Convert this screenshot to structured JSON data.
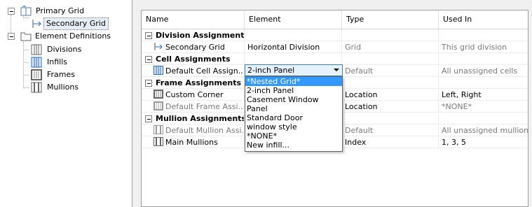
{
  "tree": {
    "nodes": [
      {
        "label": "Primary Grid",
        "icon": "grid-icon"
      },
      {
        "label": "Secondary Grid",
        "icon": "subgrid-icon"
      },
      {
        "label": "Element Definitions",
        "icon": "folder-icon"
      },
      {
        "label": "Divisions",
        "icon": "divisions-icon"
      },
      {
        "label": "Infills",
        "icon": "infills-icon"
      },
      {
        "label": "Frames",
        "icon": "frames-icon"
      },
      {
        "label": "Mullions",
        "icon": "mullions-icon"
      }
    ],
    "selected": "Secondary Grid"
  },
  "grid": {
    "columns": [
      "Name",
      "Element",
      "Type",
      "Used In"
    ],
    "rows": [
      {
        "kind": "group",
        "name": "Division Assignment"
      },
      {
        "kind": "item",
        "name": "Secondary Grid",
        "element": "Horizontal Division",
        "type": "Grid",
        "used_in": "This grid division"
      },
      {
        "kind": "group",
        "name": "Cell Assignments"
      },
      {
        "kind": "item",
        "name": "Default Cell Assign...",
        "element": "2-inch Panel",
        "type": "Default",
        "used_in": "All unassigned cells"
      },
      {
        "kind": "group",
        "name": "Frame Assignments"
      },
      {
        "kind": "item",
        "name": "Custom Corner",
        "element": "",
        "type": "Location",
        "used_in": "Left, Right"
      },
      {
        "kind": "item",
        "name": "Default Frame Assi...",
        "element": "",
        "type": "Location",
        "used_in": "*NONE*"
      },
      {
        "kind": "group",
        "name": "Mullion Assignments"
      },
      {
        "kind": "item",
        "name": "Default Mullion Assi...",
        "element": "",
        "type": "Default",
        "used_in": "All unassigned mullions"
      },
      {
        "kind": "item",
        "name": "Main Mullions",
        "element": "",
        "type": "Index",
        "used_in": "1, 3, 5"
      }
    ]
  },
  "dropdown": {
    "value": "2-inch Panel",
    "options": [
      "*Nested Grid*",
      "2-inch Panel",
      "Casement Window",
      "Panel",
      "Standard Door",
      "window style",
      "*NONE*",
      "New infill..."
    ],
    "highlighted": "*Nested Grid*"
  },
  "colors": {
    "highlight": "#3399ff",
    "dropdown_border": "#3c7fb1",
    "gray_text": "#7a7a7a"
  }
}
